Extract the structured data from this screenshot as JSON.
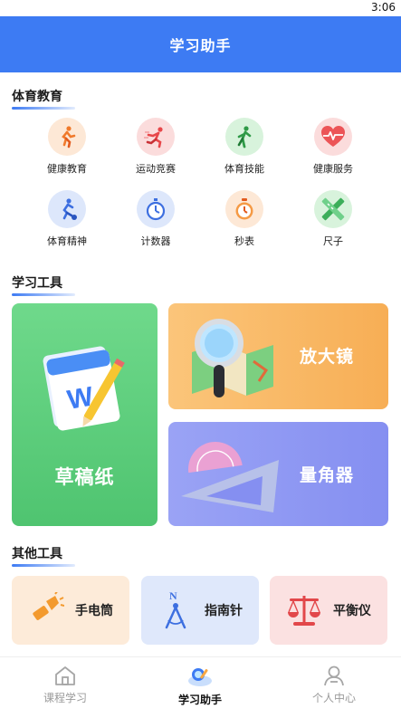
{
  "status_bar": {
    "time": "3:06"
  },
  "app_bar": {
    "title": "学习助手"
  },
  "sections": {
    "pe": "体育教育",
    "study_tools": "学习工具",
    "other_tools": "其他工具"
  },
  "pe_items": [
    {
      "label": "健康教育",
      "icon": "runner-icon",
      "color": "#fde8d6"
    },
    {
      "label": "运动竞赛",
      "icon": "sprint-icon",
      "color": "#fbdcdc"
    },
    {
      "label": "体育技能",
      "icon": "athlete-icon",
      "color": "#d8f3dc"
    },
    {
      "label": "健康服务",
      "icon": "heart-icon",
      "color": "#fbdcdc"
    },
    {
      "label": "体育精神",
      "icon": "soccer-player-icon",
      "color": "#dde7fb"
    },
    {
      "label": "计数器",
      "icon": "stopwatch-icon",
      "color": "#dde7fb"
    },
    {
      "label": "秒表",
      "icon": "timer-icon",
      "color": "#fde8d6"
    },
    {
      "label": "尺子",
      "icon": "ruler-pencil-icon",
      "color": "#d8f3dc"
    }
  ],
  "study_cards": {
    "draft": "草稿纸",
    "magnifier": "放大镜",
    "protractor": "量角器"
  },
  "other_tools": [
    {
      "label": "手电筒",
      "icon": "flashlight-icon",
      "color": "#fdebd9"
    },
    {
      "label": "指南针",
      "icon": "compass-icon",
      "color": "#dfe8fb"
    },
    {
      "label": "平衡仪",
      "icon": "balance-scale-icon",
      "color": "#fbe1e1"
    }
  ],
  "tabs": [
    {
      "label": "课程学习",
      "icon": "home-icon"
    },
    {
      "label": "学习助手",
      "icon": "assistant-icon"
    },
    {
      "label": "个人中心",
      "icon": "person-icon"
    }
  ],
  "colors": {
    "primary": "#3d7bf3",
    "draft_card": "#5bcd7a",
    "magnifier_card": "#f8b35c",
    "protractor_card": "#8c95f3"
  }
}
